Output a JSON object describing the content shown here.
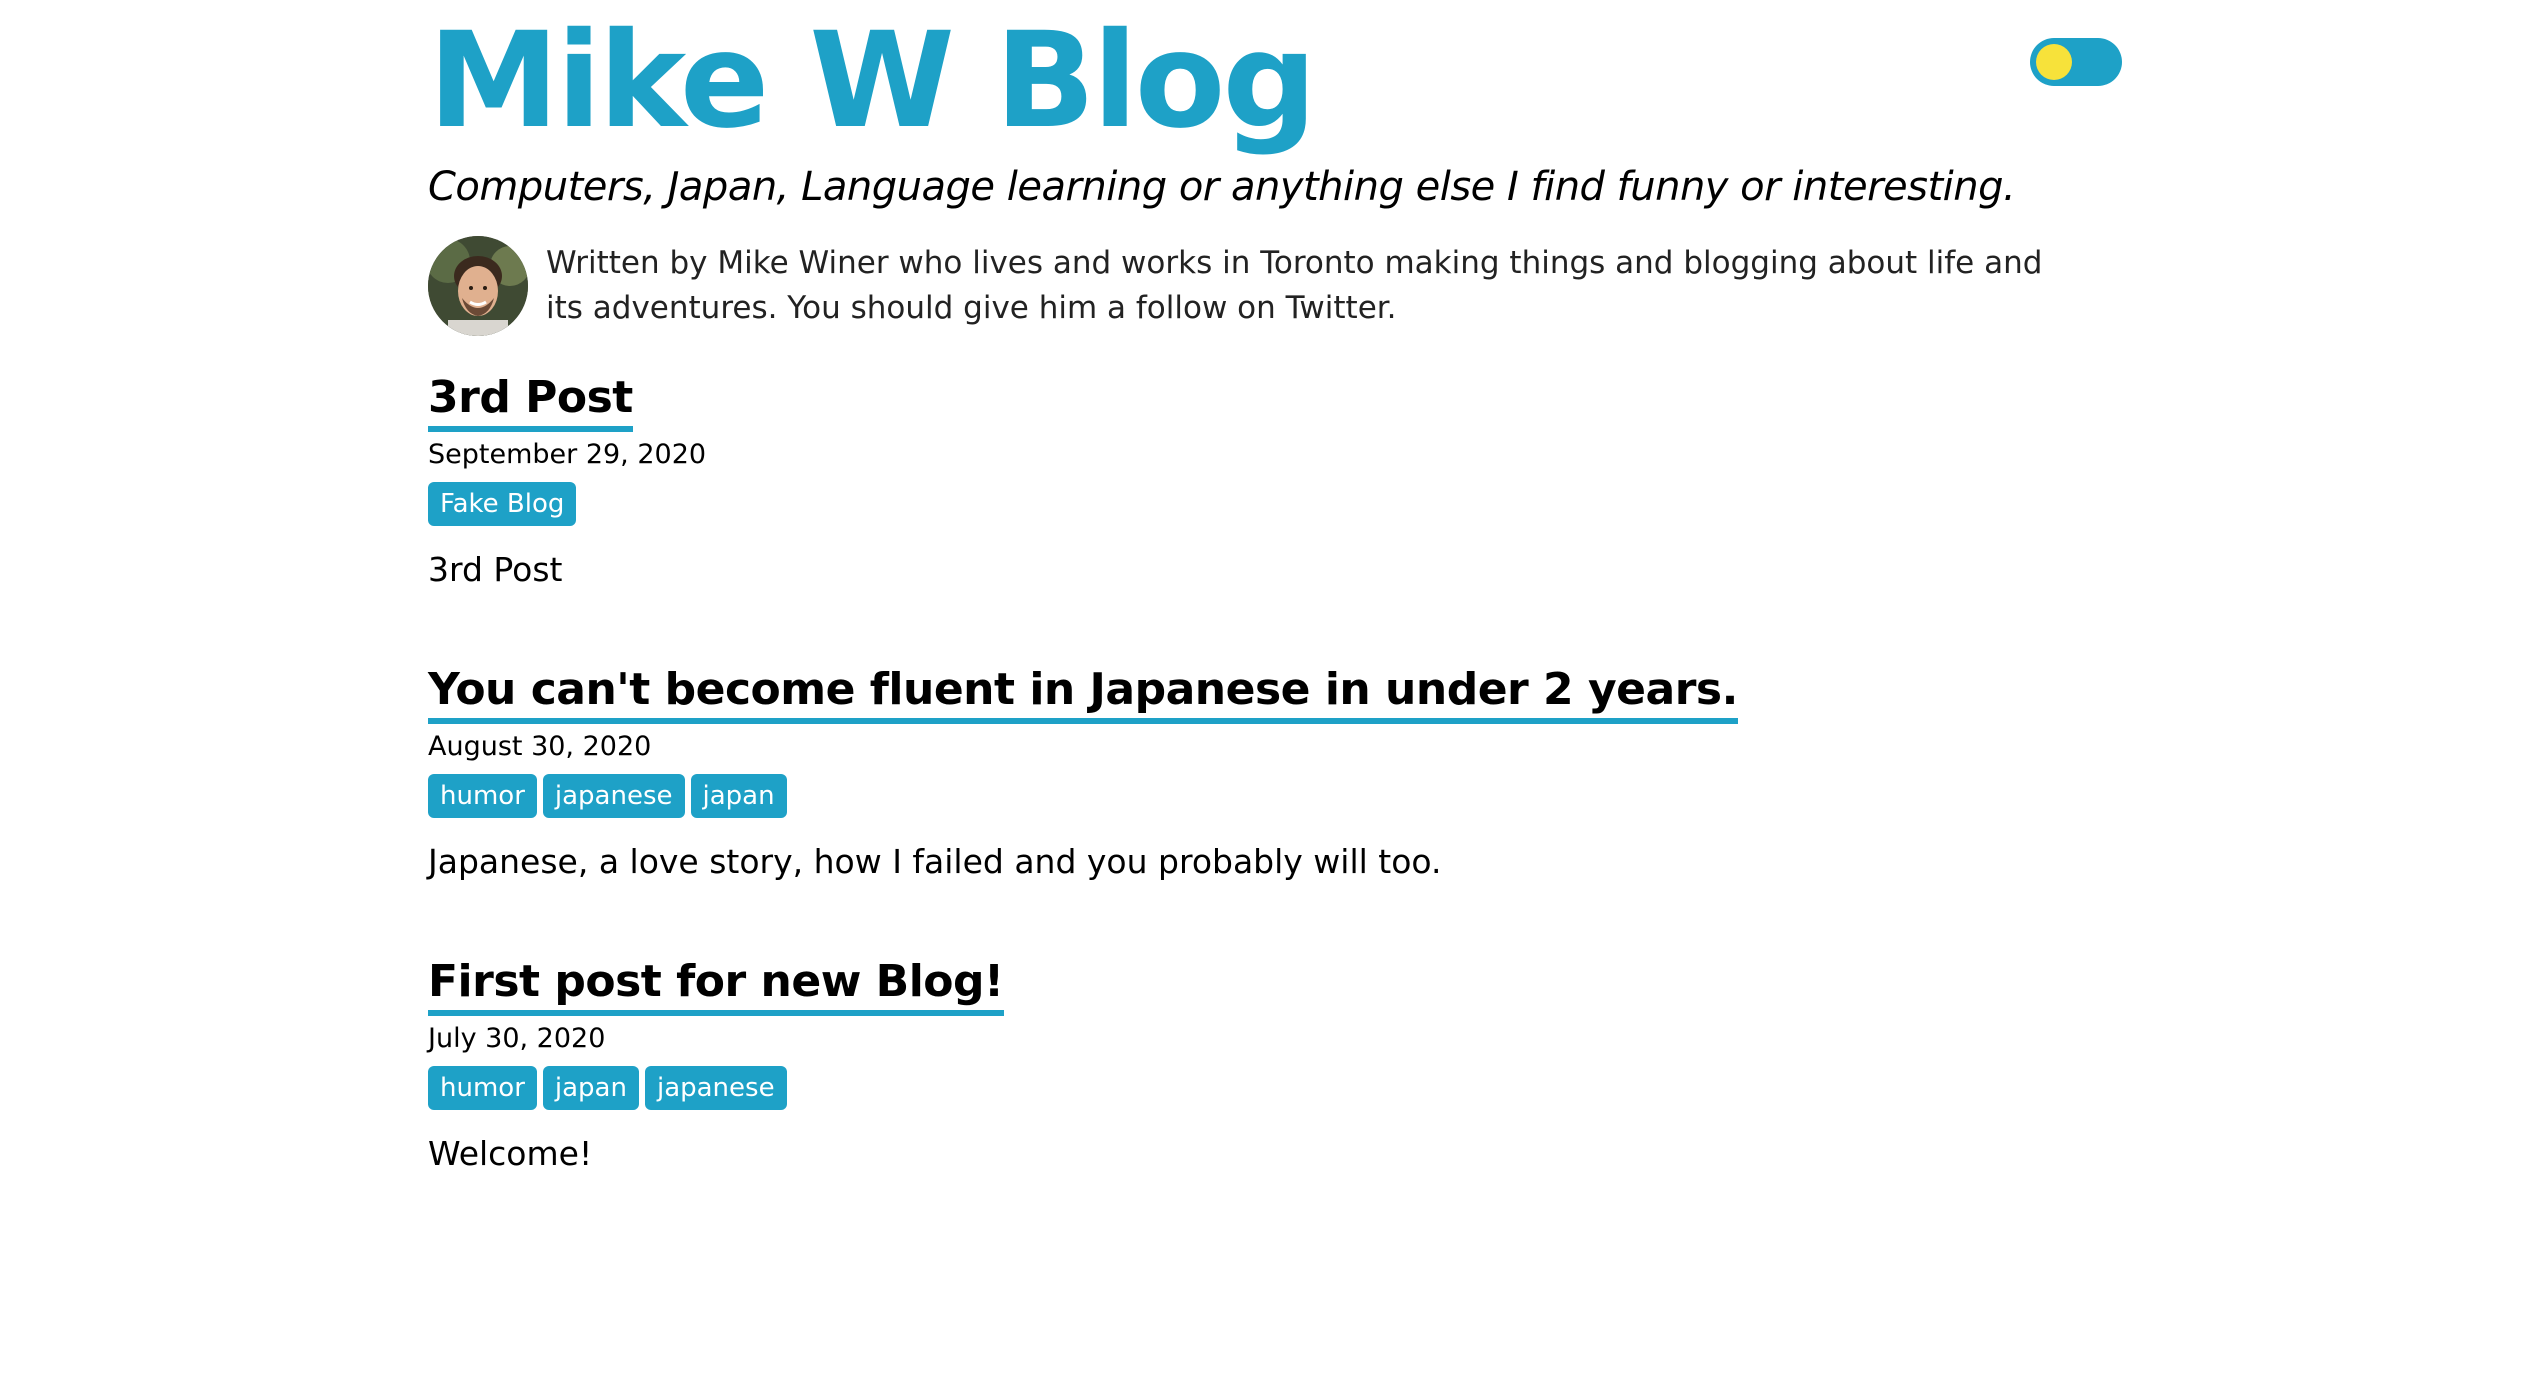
{
  "site": {
    "title": "Mike W Blog",
    "tagline": "Computers, Japan, Language learning or anything else I find funny or interesting.",
    "bio": "Written by Mike Winer who lives and works in Toronto making things and blogging about life and its adventures. You should give him a follow on Twitter."
  },
  "theme_toggle": {
    "state": "light",
    "colors": {
      "track": "#1ea1c7",
      "knob": "#f7e23a"
    }
  },
  "colors": {
    "accent": "#1ea1c7",
    "text": "#000000",
    "background": "#ffffff"
  },
  "posts": [
    {
      "title": "3rd Post",
      "date": "September 29, 2020",
      "tags": [
        "Fake Blog"
      ],
      "excerpt": "3rd Post"
    },
    {
      "title": "You can't become fluent in Japanese in under 2 years.",
      "date": "August 30, 2020",
      "tags": [
        "humor",
        "japanese",
        "japan"
      ],
      "excerpt": "Japanese, a love story, how I failed and you probably will too."
    },
    {
      "title": "First post for new Blog!",
      "date": "July 30, 2020",
      "tags": [
        "humor",
        "japan",
        "japanese"
      ],
      "excerpt": "Welcome!"
    }
  ]
}
